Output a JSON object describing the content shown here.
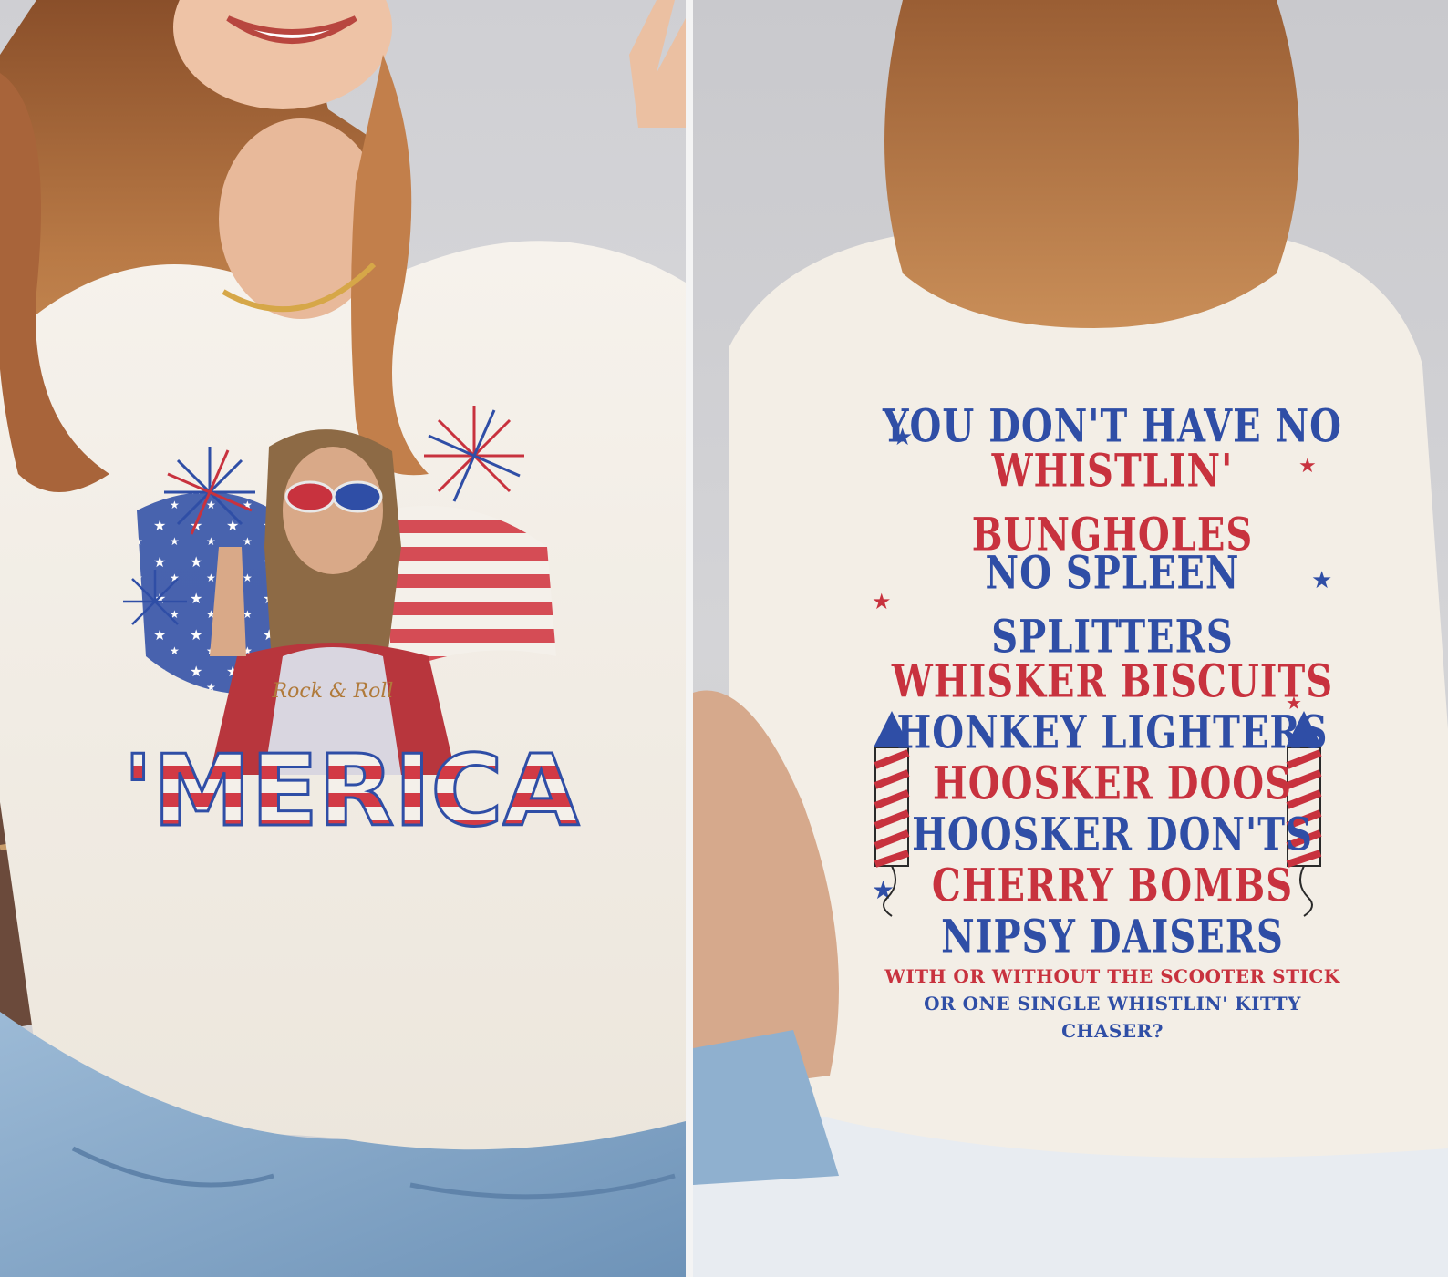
{
  "front": {
    "headline": "'MERICA",
    "shirt_text": "Rock & Roll"
  },
  "back": {
    "lines": [
      {
        "text": "YOU DON'T HAVE NO",
        "color": "#2f4ea6"
      },
      {
        "text": "WHISTLIN' BUNGHOLES",
        "color": "#c8323e"
      },
      {
        "text": "NO SPLEEN SPLITTERS",
        "color": "#2f4ea6"
      },
      {
        "text": "WHISKER BISCUITS",
        "color": "#c8323e"
      },
      {
        "text": "HONKEY LIGHTERS",
        "color": "#2f4ea6"
      },
      {
        "text": "HOOSKER DOOS",
        "color": "#c8323e"
      },
      {
        "text": "HOOSKER DON'TS",
        "color": "#2f4ea6"
      },
      {
        "text": "CHERRY BOMBS",
        "color": "#c8323e"
      },
      {
        "text": "NIPSY DAISERS",
        "color": "#2f4ea6"
      }
    ],
    "small_lines": [
      {
        "text": "WITH OR WITHOUT THE SCOOTER STICK",
        "color": "#c8323e"
      },
      {
        "text": "OR ONE SINGLE WHISTLIN' KITTY CHASER?",
        "color": "#2f4ea6"
      }
    ]
  },
  "colors": {
    "red": "#c8323e",
    "blue": "#2f4ea6",
    "shirt": "#f3eee6",
    "hair": "#b5703f",
    "jeans": "#8fb0cf"
  }
}
